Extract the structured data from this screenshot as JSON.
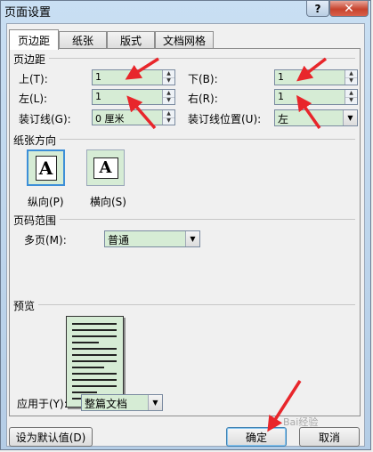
{
  "window": {
    "title": "页面设置",
    "help_label": "?",
    "close_label": "✕"
  },
  "tabs": [
    {
      "label": "页边距",
      "active": true
    },
    {
      "label": "纸张",
      "active": false
    },
    {
      "label": "版式",
      "active": false
    },
    {
      "label": "文档网格",
      "active": false
    }
  ],
  "margins": {
    "group_label": "页边距",
    "top_label": "上(T):",
    "top_value": "1",
    "bottom_label": "下(B):",
    "bottom_value": "1",
    "left_label": "左(L):",
    "left_value": "1",
    "right_label": "右(R):",
    "right_value": "1",
    "gutter_label": "装订线(G):",
    "gutter_value": "0 厘米",
    "gutter_pos_label": "装订线位置(U):",
    "gutter_pos_value": "左"
  },
  "orientation": {
    "group_label": "纸张方向",
    "portrait_label": "纵向(P)",
    "landscape_label": "横向(S)",
    "portrait_glyph": "A",
    "landscape_glyph": "A",
    "selected": "portrait"
  },
  "pages": {
    "group_label": "页码范围",
    "multi_label": "多页(M):",
    "multi_value": "普通"
  },
  "preview": {
    "group_label": "预览",
    "apply_label": "应用于(Y):",
    "apply_value": "整篇文档"
  },
  "buttons": {
    "default_label": "设为默认值(D)",
    "ok_label": "确定",
    "cancel_label": "取消"
  },
  "watermark": "Bai经验",
  "colors": {
    "field_bg": "#d6ecd5",
    "arrow": "#e8262b",
    "focus": "#3d8fd8"
  }
}
